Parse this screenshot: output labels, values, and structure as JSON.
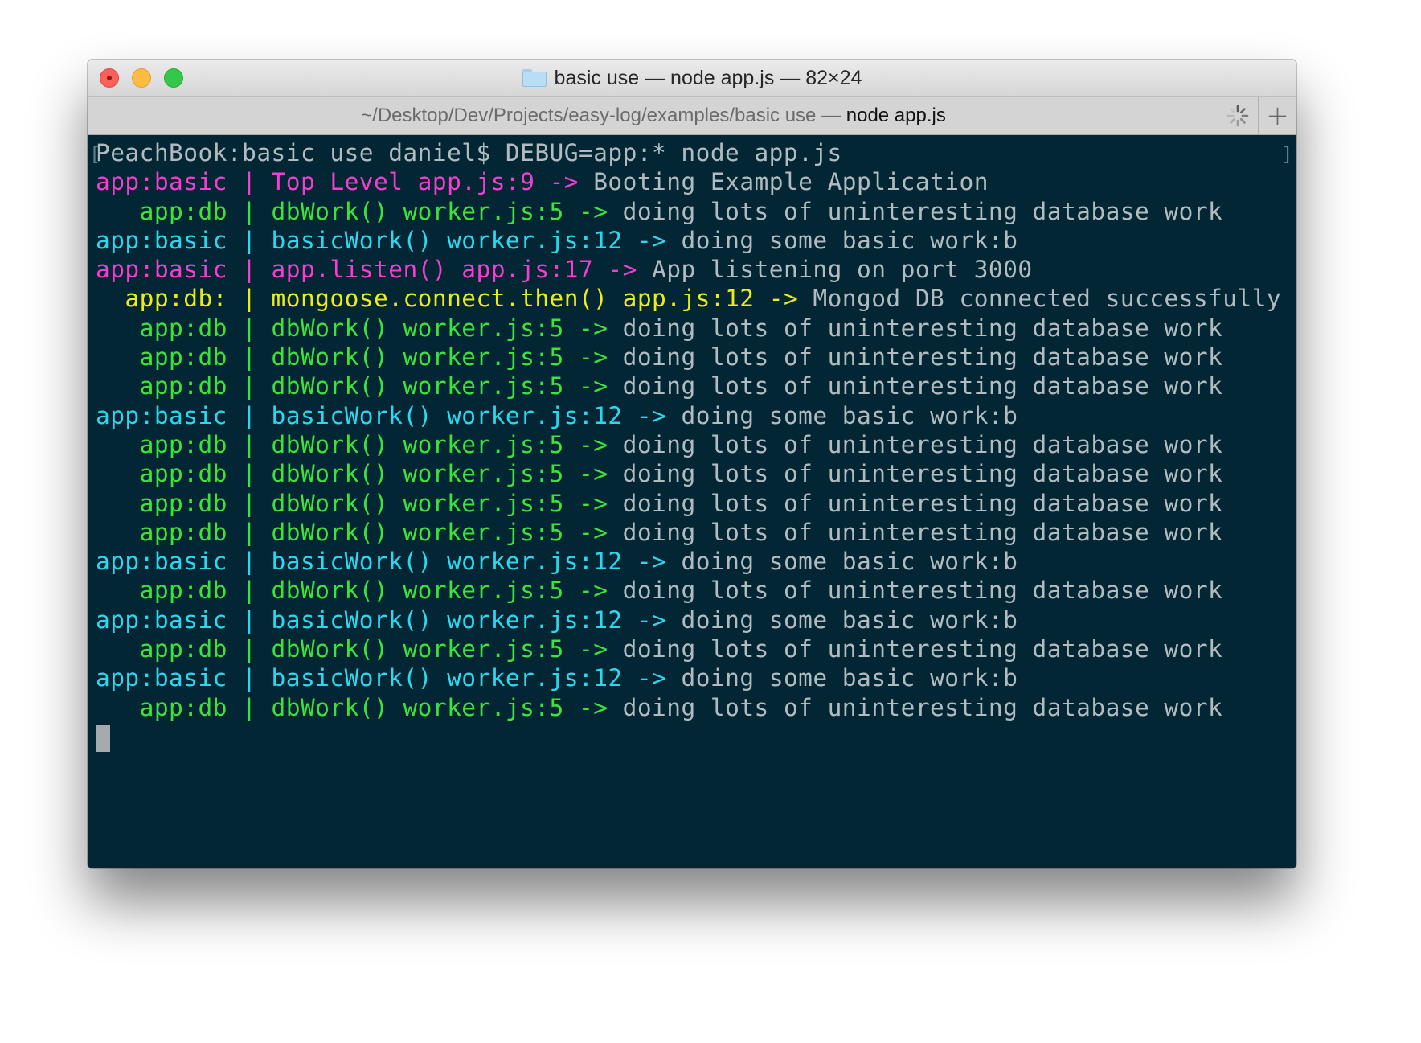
{
  "window": {
    "title": "basic use — node app.js — 82×24"
  },
  "tab": {
    "path": "~/Desktop/Dev/Projects/easy-log/examples/basic use",
    "separator": " — ",
    "process": "node app.js",
    "new_tab": "+"
  },
  "terminal": {
    "prompt": "PeachBook:basic use daniel$ DEBUG=app:* node app.js",
    "lines": [
      {
        "ns": "app:basic",
        "sep": " | ",
        "fn": "Top Level",
        "loc": "app.js:9",
        "arrow": "->",
        "msg": "Booting Example Application",
        "color": "magenta"
      },
      {
        "ns": "   app:db",
        "sep": " | ",
        "fn": "dbWork()",
        "loc": "worker.js:5",
        "arrow": "->",
        "msg": "doing lots of uninteresting database work",
        "color": "green"
      },
      {
        "ns": "app:basic",
        "sep": " | ",
        "fn": "basicWork()",
        "loc": "worker.js:12",
        "arrow": "->",
        "msg": "doing some basic work:b",
        "color": "cyan"
      },
      {
        "ns": "app:basic",
        "sep": " | ",
        "fn": "app.listen()",
        "loc": "app.js:17",
        "arrow": "->",
        "msg": "App listening on port 3000",
        "color": "magenta"
      },
      {
        "ns": "  app:db:",
        "sep": " | ",
        "fn": "mongoose.connect.then()",
        "loc": "app.js:12",
        "arrow": "->",
        "msg": "Mongod DB connected successfully",
        "color": "yellow"
      },
      {
        "ns": "   app:db",
        "sep": " | ",
        "fn": "dbWork()",
        "loc": "worker.js:5",
        "arrow": "->",
        "msg": "doing lots of uninteresting database work",
        "color": "green"
      },
      {
        "ns": "   app:db",
        "sep": " | ",
        "fn": "dbWork()",
        "loc": "worker.js:5",
        "arrow": "->",
        "msg": "doing lots of uninteresting database work",
        "color": "green"
      },
      {
        "ns": "   app:db",
        "sep": " | ",
        "fn": "dbWork()",
        "loc": "worker.js:5",
        "arrow": "->",
        "msg": "doing lots of uninteresting database work",
        "color": "green"
      },
      {
        "ns": "app:basic",
        "sep": " | ",
        "fn": "basicWork()",
        "loc": "worker.js:12",
        "arrow": "->",
        "msg": "doing some basic work:b",
        "color": "cyan"
      },
      {
        "ns": "   app:db",
        "sep": " | ",
        "fn": "dbWork()",
        "loc": "worker.js:5",
        "arrow": "->",
        "msg": "doing lots of uninteresting database work",
        "color": "green"
      },
      {
        "ns": "   app:db",
        "sep": " | ",
        "fn": "dbWork()",
        "loc": "worker.js:5",
        "arrow": "->",
        "msg": "doing lots of uninteresting database work",
        "color": "green"
      },
      {
        "ns": "   app:db",
        "sep": " | ",
        "fn": "dbWork()",
        "loc": "worker.js:5",
        "arrow": "->",
        "msg": "doing lots of uninteresting database work",
        "color": "green"
      },
      {
        "ns": "   app:db",
        "sep": " | ",
        "fn": "dbWork()",
        "loc": "worker.js:5",
        "arrow": "->",
        "msg": "doing lots of uninteresting database work",
        "color": "green"
      },
      {
        "ns": "app:basic",
        "sep": " | ",
        "fn": "basicWork()",
        "loc": "worker.js:12",
        "arrow": "->",
        "msg": "doing some basic work:b",
        "color": "cyan"
      },
      {
        "ns": "   app:db",
        "sep": " | ",
        "fn": "dbWork()",
        "loc": "worker.js:5",
        "arrow": "->",
        "msg": "doing lots of uninteresting database work",
        "color": "green"
      },
      {
        "ns": "app:basic",
        "sep": " | ",
        "fn": "basicWork()",
        "loc": "worker.js:12",
        "arrow": "->",
        "msg": "doing some basic work:b",
        "color": "cyan"
      },
      {
        "ns": "   app:db",
        "sep": " | ",
        "fn": "dbWork()",
        "loc": "worker.js:5",
        "arrow": "->",
        "msg": "doing lots of uninteresting database work",
        "color": "green"
      },
      {
        "ns": "app:basic",
        "sep": " | ",
        "fn": "basicWork()",
        "loc": "worker.js:12",
        "arrow": "->",
        "msg": "doing some basic work:b",
        "color": "cyan"
      },
      {
        "ns": "   app:db",
        "sep": " | ",
        "fn": "dbWork()",
        "loc": "worker.js:5",
        "arrow": "->",
        "msg": "doing lots of uninteresting database work",
        "color": "green"
      }
    ]
  },
  "colors": {
    "terminal_bg": "#022634",
    "text": "#b2bcc0",
    "magenta": "#f23fd0",
    "green": "#3ee23a",
    "cyan": "#2fd7ee",
    "yellow": "#ecec18"
  },
  "icons": [
    "close-icon",
    "minimize-icon",
    "zoom-icon",
    "folder-icon",
    "spinner-icon",
    "plus-icon"
  ]
}
